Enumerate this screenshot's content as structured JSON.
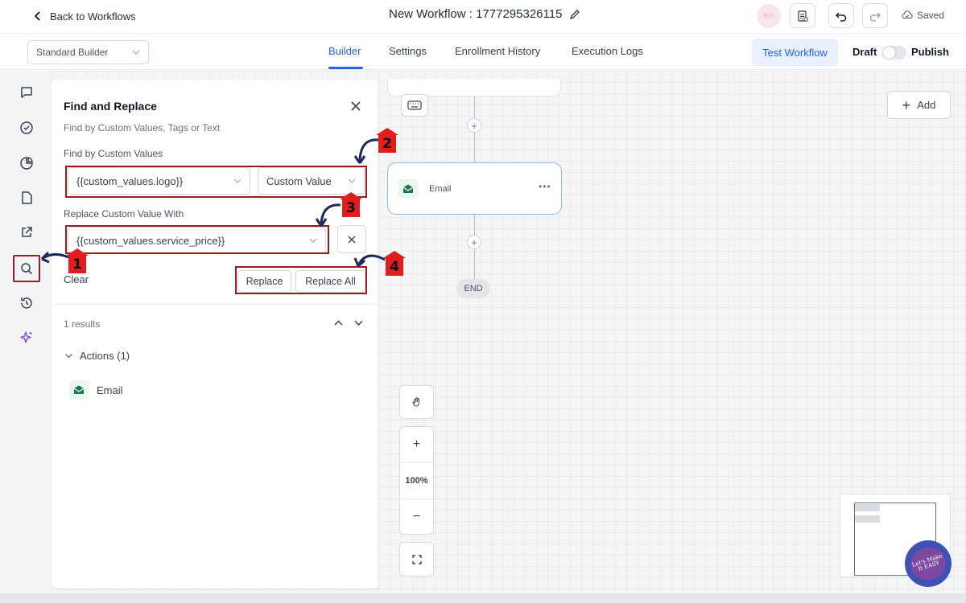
{
  "header": {
    "back_label": "Back to Workflows",
    "workflow_title": "New Workflow : 1777295326115",
    "avatar_initials": "BR",
    "saved_label": "Saved"
  },
  "subbar": {
    "builder_mode": "Standard Builder",
    "tabs": [
      {
        "label": "Builder",
        "active": true
      },
      {
        "label": "Settings",
        "active": false
      },
      {
        "label": "Enrollment History",
        "active": false
      },
      {
        "label": "Execution Logs",
        "active": false
      }
    ],
    "test_workflow_label": "Test Workflow",
    "draft_label": "Draft",
    "publish_label": "Publish",
    "publish_toggle_on": false
  },
  "find_replace": {
    "title": "Find and Replace",
    "subtitle": "Find by Custom Values, Tags or Text",
    "find_label": "Find by Custom Values",
    "find_value": "{{custom_values.logo}}",
    "find_type": "Custom Value",
    "replace_label": "Replace Custom Value With",
    "replace_value": "{{custom_values.service_price}}",
    "clear_label": "Clear",
    "replace_label_btn": "Replace",
    "replace_all_label": "Replace All",
    "results_count": "1 results",
    "group_label": "Actions (1)",
    "result_item": "Email"
  },
  "annotations": [
    "1",
    "2",
    "3",
    "4"
  ],
  "canvas": {
    "add_label": "Add",
    "email_node_label": "Email",
    "end_label": "END",
    "zoom_level": "100%"
  },
  "watermark": {
    "text": "Let's Make It EASY"
  },
  "colors": {
    "accent": "#2563eb",
    "annotation_red": "#e11d1d",
    "annotation_border": "#9b1c1c",
    "arrow_navy": "#1e2a5a",
    "email_green": "#16794a"
  }
}
